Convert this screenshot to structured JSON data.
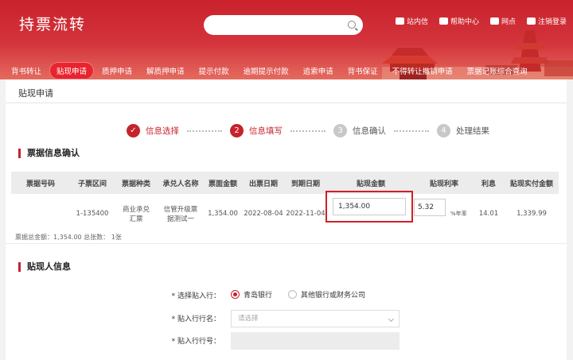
{
  "header": {
    "brand": "持票流转",
    "search_placeholder": "",
    "tools": [
      {
        "label": "站内信",
        "icon": "mail-icon"
      },
      {
        "label": "帮助中心",
        "icon": "help-icon"
      },
      {
        "label": "网点",
        "icon": "branch-icon"
      },
      {
        "label": "注销登录",
        "icon": "logout-icon"
      }
    ]
  },
  "nav": {
    "items": [
      {
        "label": "背书转让",
        "active": false
      },
      {
        "label": "贴现申请",
        "active": true
      },
      {
        "label": "质押申请",
        "active": false
      },
      {
        "label": "解质押申请",
        "active": false
      },
      {
        "label": "提示付款",
        "active": false
      },
      {
        "label": "逾期提示付款",
        "active": false
      },
      {
        "label": "追索申请",
        "active": false
      },
      {
        "label": "背书保证",
        "active": false
      },
      {
        "label": "不得转让撤销申请",
        "active": false
      },
      {
        "label": "票据记账综合查询",
        "active": false
      }
    ]
  },
  "page": {
    "title": "贴现申请"
  },
  "steps": [
    {
      "num": "✓",
      "label": "信息选择",
      "state": "done"
    },
    {
      "num": "2",
      "label": "信息填写",
      "state": "cur"
    },
    {
      "num": "3",
      "label": "信息确认",
      "state": "todo"
    },
    {
      "num": "4",
      "label": "处理结果",
      "state": "todo"
    }
  ],
  "bill_section": {
    "title": "票据信息确认"
  },
  "table": {
    "headers": [
      "票据号码",
      "子票区间",
      "票据种类",
      "承兑人名称",
      "票面金额",
      "出票日期",
      "到期日期",
      "贴现金额",
      "贴现利率",
      "利息",
      "贴现实付金额"
    ],
    "row": {
      "bill_no": "",
      "sub_range": "1-135400",
      "bill_type": "商业承兑汇票",
      "acceptor": "信管升级票据测试一",
      "face_amount": "1,354.00",
      "issue_date": "2022-08-04",
      "due_date": "2022-11-04",
      "discount_amount": "1,354.00",
      "discount_rate": "5.32",
      "rate_unit": "%年率",
      "interest": "14.01",
      "net_amount": "1,339.99"
    },
    "summary": "票据总金额：1,354.00 总张数： 1张"
  },
  "discount_section": {
    "title": "贴现人信息"
  },
  "form": {
    "bank_label": "* 选择贴入行：",
    "bank_options": [
      {
        "label": "青岛银行",
        "selected": true
      },
      {
        "label": "其他银行或财务公司",
        "selected": false
      }
    ],
    "bank_name_label": "* 贴入行行名：",
    "bank_name_placeholder": "请选择",
    "bank_no_label": "* 贴入行行号："
  },
  "colors": {
    "brand_red": "#c6232c",
    "highlight_border": "#d0202a"
  }
}
